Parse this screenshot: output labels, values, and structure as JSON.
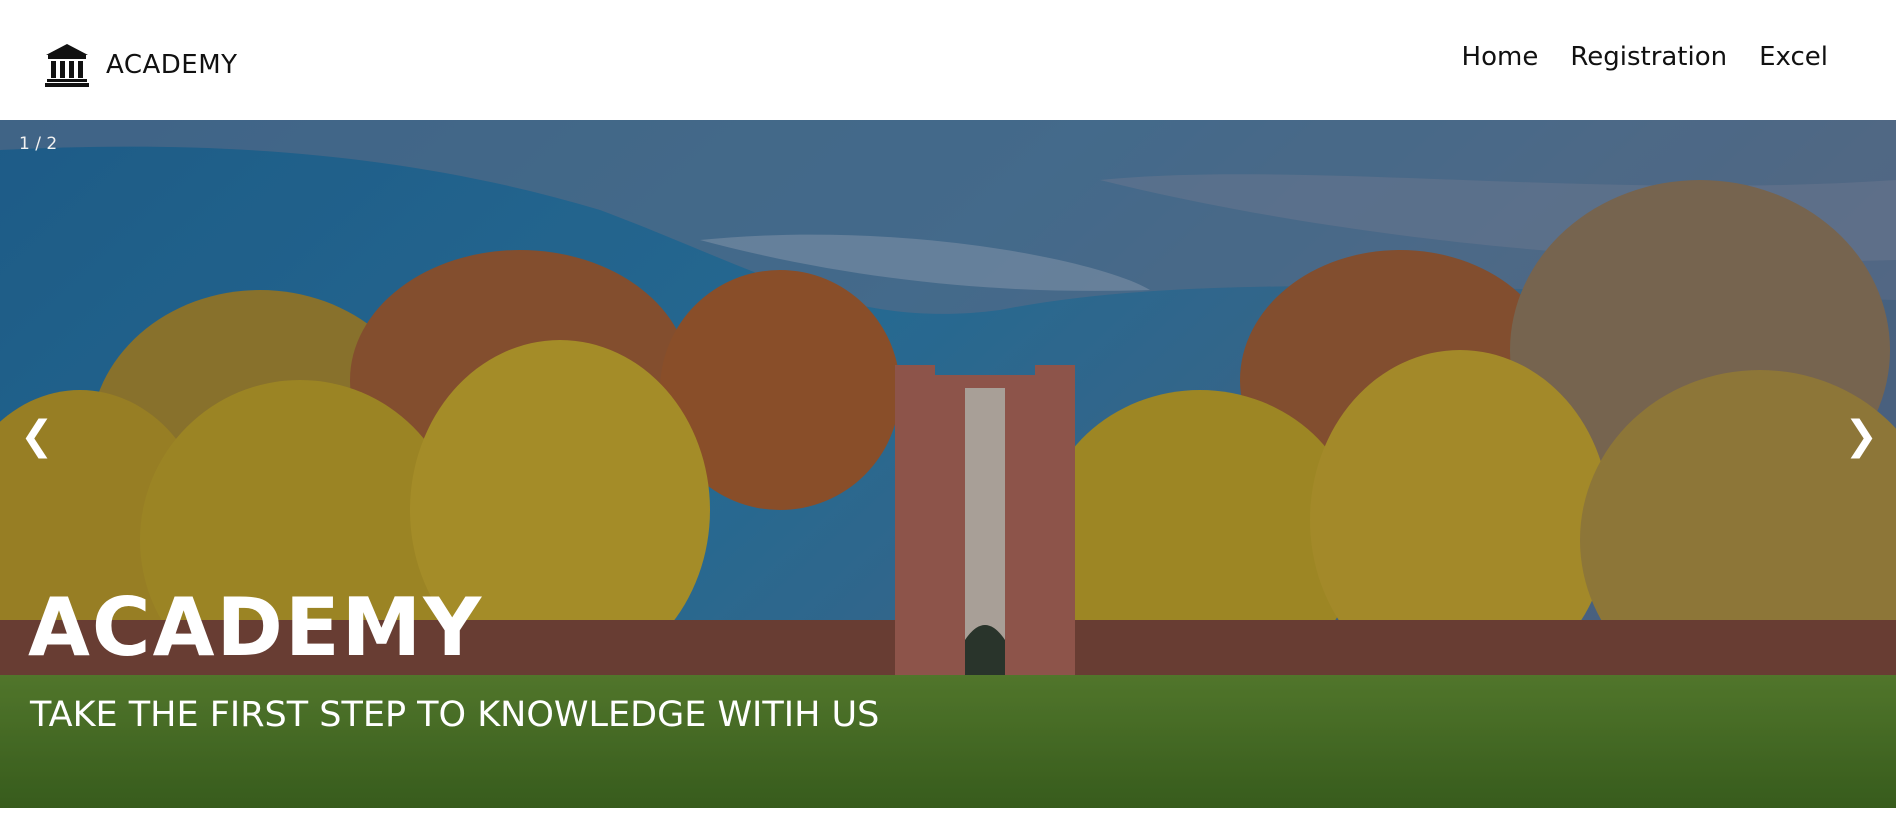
{
  "navbar": {
    "brand_icon": "bank-building-icon",
    "brand_text": "ACADEMY",
    "links": [
      {
        "label": "Home"
      },
      {
        "label": "Registration"
      },
      {
        "label": "Excel"
      }
    ]
  },
  "hero": {
    "slide_counter": "1 / 2",
    "prev_arrow": "❮",
    "next_arrow": "❯",
    "title": "ACADEMY",
    "subtitle": "TAKE THE FIRST STEP TO KNOWLEDGE WITIH US",
    "image_subject": "campus-building-autumn-trees-photo"
  },
  "colors": {
    "sky": "#2e6f98",
    "grass": "#4f7a22",
    "brick": "#a86150",
    "foliage_yellow": "#c3a223",
    "foliage_orange": "#a65d2c",
    "text_dark": "#111111",
    "text_light": "#ffffff"
  }
}
